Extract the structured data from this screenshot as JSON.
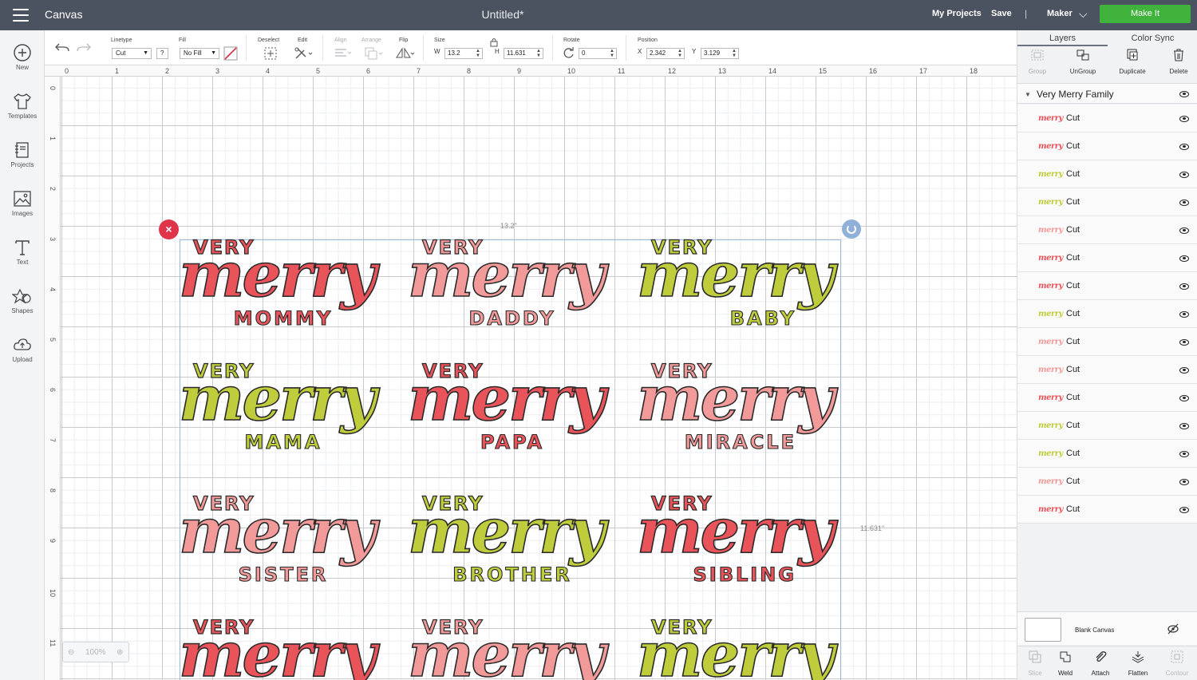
{
  "topbar": {
    "app_title": "Canvas",
    "doc_title": "Untitled*",
    "my_projects": "My Projects",
    "save": "Save",
    "separator": "|",
    "machine": "Maker",
    "make_it": "Make It",
    "make_it_color": "#3fb33c"
  },
  "leftbar": {
    "items": [
      {
        "label": "New",
        "icon": "plus-circle-icon"
      },
      {
        "label": "Templates",
        "icon": "tshirt-icon"
      },
      {
        "label": "Projects",
        "icon": "notebook-icon"
      },
      {
        "label": "Images",
        "icon": "image-icon"
      },
      {
        "label": "Text",
        "icon": "text-t-icon"
      },
      {
        "label": "Shapes",
        "icon": "shapes-icon"
      },
      {
        "label": "Upload",
        "icon": "cloud-upload-icon"
      }
    ]
  },
  "toolbar": {
    "linetype_label": "Linetype",
    "linetype_value": "Cut",
    "help": "?",
    "fill_label": "Fill",
    "fill_value": "No Fill",
    "deselect_label": "Deselect",
    "edit_label": "Edit",
    "align_label": "Align",
    "arrange_label": "Arrange",
    "flip_label": "Flip",
    "size_label": "Size",
    "w_label": "W",
    "w_value": "13.2",
    "h_label": "H",
    "h_value": "11.631",
    "rotate_label": "Rotate",
    "rotate_value": "0",
    "position_label": "Position",
    "x_label": "X",
    "x_value": "2.342",
    "y_label": "Y",
    "y_value": "3.129"
  },
  "canvas": {
    "ruler_top": [
      "0",
      "1",
      "2",
      "3",
      "4",
      "5",
      "6",
      "7",
      "8",
      "9",
      "10",
      "11",
      "12",
      "13",
      "14",
      "15",
      "16",
      "17",
      "18"
    ],
    "ruler_left": [
      "0",
      "1",
      "2",
      "3",
      "4",
      "5",
      "6",
      "7",
      "8",
      "9",
      "10",
      "11"
    ],
    "width_label": "13.2\"",
    "height_label": "11.631\"",
    "zoom": "100%",
    "designs": [
      {
        "very": "VERY",
        "merry": "merry",
        "name": "MOMMY",
        "color": "#e8545a"
      },
      {
        "very": "VERY",
        "merry": "merry",
        "name": "DADDY",
        "color": "#f29a9a"
      },
      {
        "very": "VERY",
        "merry": "merry",
        "name": "BABY",
        "color": "#bfcd3c"
      },
      {
        "very": "VERY",
        "merry": "merry",
        "name": "MAMA",
        "color": "#bfcd3c"
      },
      {
        "very": "VERY",
        "merry": "merry",
        "name": "PAPA",
        "color": "#e8545a"
      },
      {
        "very": "VERY",
        "merry": "merry",
        "name": "MIRACLE",
        "color": "#f29a9a"
      },
      {
        "very": "VERY",
        "merry": "merry",
        "name": "SISTER",
        "color": "#f29a9a"
      },
      {
        "very": "VERY",
        "merry": "merry",
        "name": "BROTHER",
        "color": "#bfcd3c"
      },
      {
        "very": "VERY",
        "merry": "merry",
        "name": "SIBLING",
        "color": "#e8545a"
      },
      {
        "very": "VERY",
        "merry": "merry",
        "name": "",
        "color": "#e8545a"
      },
      {
        "very": "VERY",
        "merry": "merry",
        "name": "",
        "color": "#f29a9a"
      },
      {
        "very": "VERY",
        "merry": "merry",
        "name": "",
        "color": "#bfcd3c"
      }
    ]
  },
  "panel": {
    "tabs": [
      "Layers",
      "Color Sync"
    ],
    "tools": [
      {
        "label": "Group",
        "enabled": false
      },
      {
        "label": "UnGroup",
        "enabled": true
      },
      {
        "label": "Duplicate",
        "enabled": true
      },
      {
        "label": "Delete",
        "enabled": true
      }
    ],
    "group_name": "Very Merry Family",
    "layers": [
      {
        "name": "Cut",
        "color": "#e8545a"
      },
      {
        "name": "Cut",
        "color": "#e8545a"
      },
      {
        "name": "Cut",
        "color": "#bfcd3c"
      },
      {
        "name": "Cut",
        "color": "#bfcd3c"
      },
      {
        "name": "Cut",
        "color": "#f29a9a"
      },
      {
        "name": "Cut",
        "color": "#e8545a"
      },
      {
        "name": "Cut",
        "color": "#e8545a"
      },
      {
        "name": "Cut",
        "color": "#bfcd3c"
      },
      {
        "name": "Cut",
        "color": "#f29a9a"
      },
      {
        "name": "Cut",
        "color": "#f29a9a"
      },
      {
        "name": "Cut",
        "color": "#e8545a"
      },
      {
        "name": "Cut",
        "color": "#bfcd3c"
      },
      {
        "name": "Cut",
        "color": "#bfcd3c"
      },
      {
        "name": "Cut",
        "color": "#f29a9a"
      },
      {
        "name": "Cut",
        "color": "#e8545a"
      }
    ],
    "blank_canvas": "Blank Canvas",
    "actions": [
      {
        "label": "Slice",
        "enabled": false
      },
      {
        "label": "Weld",
        "enabled": true
      },
      {
        "label": "Attach",
        "enabled": true
      },
      {
        "label": "Flatten",
        "enabled": true
      },
      {
        "label": "Contour",
        "enabled": false
      }
    ]
  }
}
